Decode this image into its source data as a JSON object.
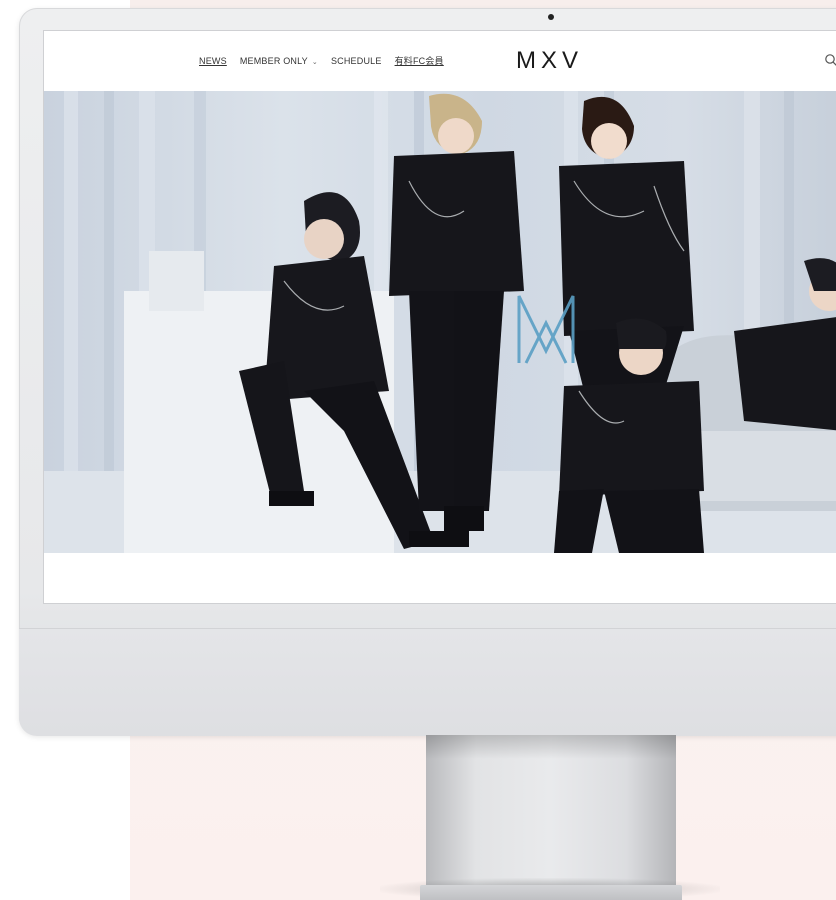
{
  "site": {
    "nav": {
      "news": "NEWS",
      "member_only": "MEMBER ONLY",
      "schedule": "SCHEDULE",
      "paid_fc": "有料FC会員"
    },
    "logo_text": "MXV"
  },
  "icons": {
    "chevron": "chevron-down-icon",
    "search": "search-icon"
  },
  "colors": {
    "accent": "#5a9fc4",
    "text": "#1a1a1a"
  }
}
